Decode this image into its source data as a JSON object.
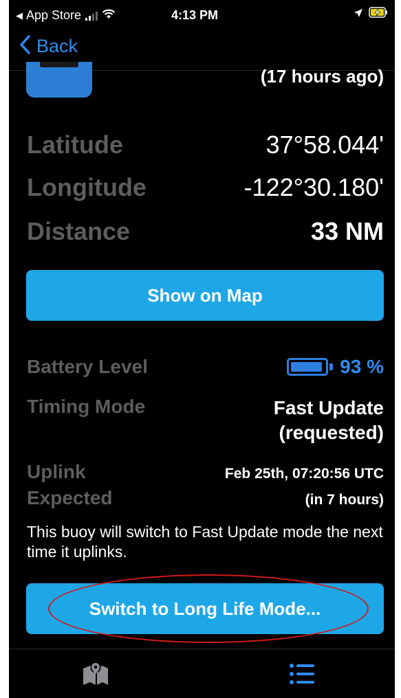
{
  "status_bar": {
    "carrier": "App Store",
    "time": "4:13 PM"
  },
  "nav": {
    "back_label": "Back"
  },
  "header": {
    "updated_ago": "(17 hours ago)"
  },
  "position": {
    "latitude_label": "Latitude",
    "latitude_value": "37°58.044'",
    "longitude_label": "Longitude",
    "longitude_value": "-122°30.180'",
    "distance_label": "Distance",
    "distance_value": "33 NM"
  },
  "show_map_button": "Show on Map",
  "status": {
    "battery_label": "Battery Level",
    "battery_value": "93 %",
    "battery_fraction": 0.93,
    "timing_label": "Timing Mode",
    "timing_value_line1": "Fast Update",
    "timing_value_line2": "(requested)",
    "uplink_label_line1": "Uplink",
    "uplink_label_line2": "Expected",
    "uplink_value_line1": "Feb 25th, 07:20:56 UTC",
    "uplink_value_line2": "(in 7 hours)"
  },
  "note": "This buoy will switch to Fast Update mode the next time it uplinks.",
  "switch_button": "Switch to Long Life Mode...",
  "tabs": [
    {
      "icon": "map-icon"
    },
    {
      "icon": "list-icon"
    }
  ],
  "colors": {
    "accent": "#1ea7e6",
    "link": "#2e8cf0",
    "label_gray": "#5d5d5d",
    "annotation": "#d11a1a"
  }
}
